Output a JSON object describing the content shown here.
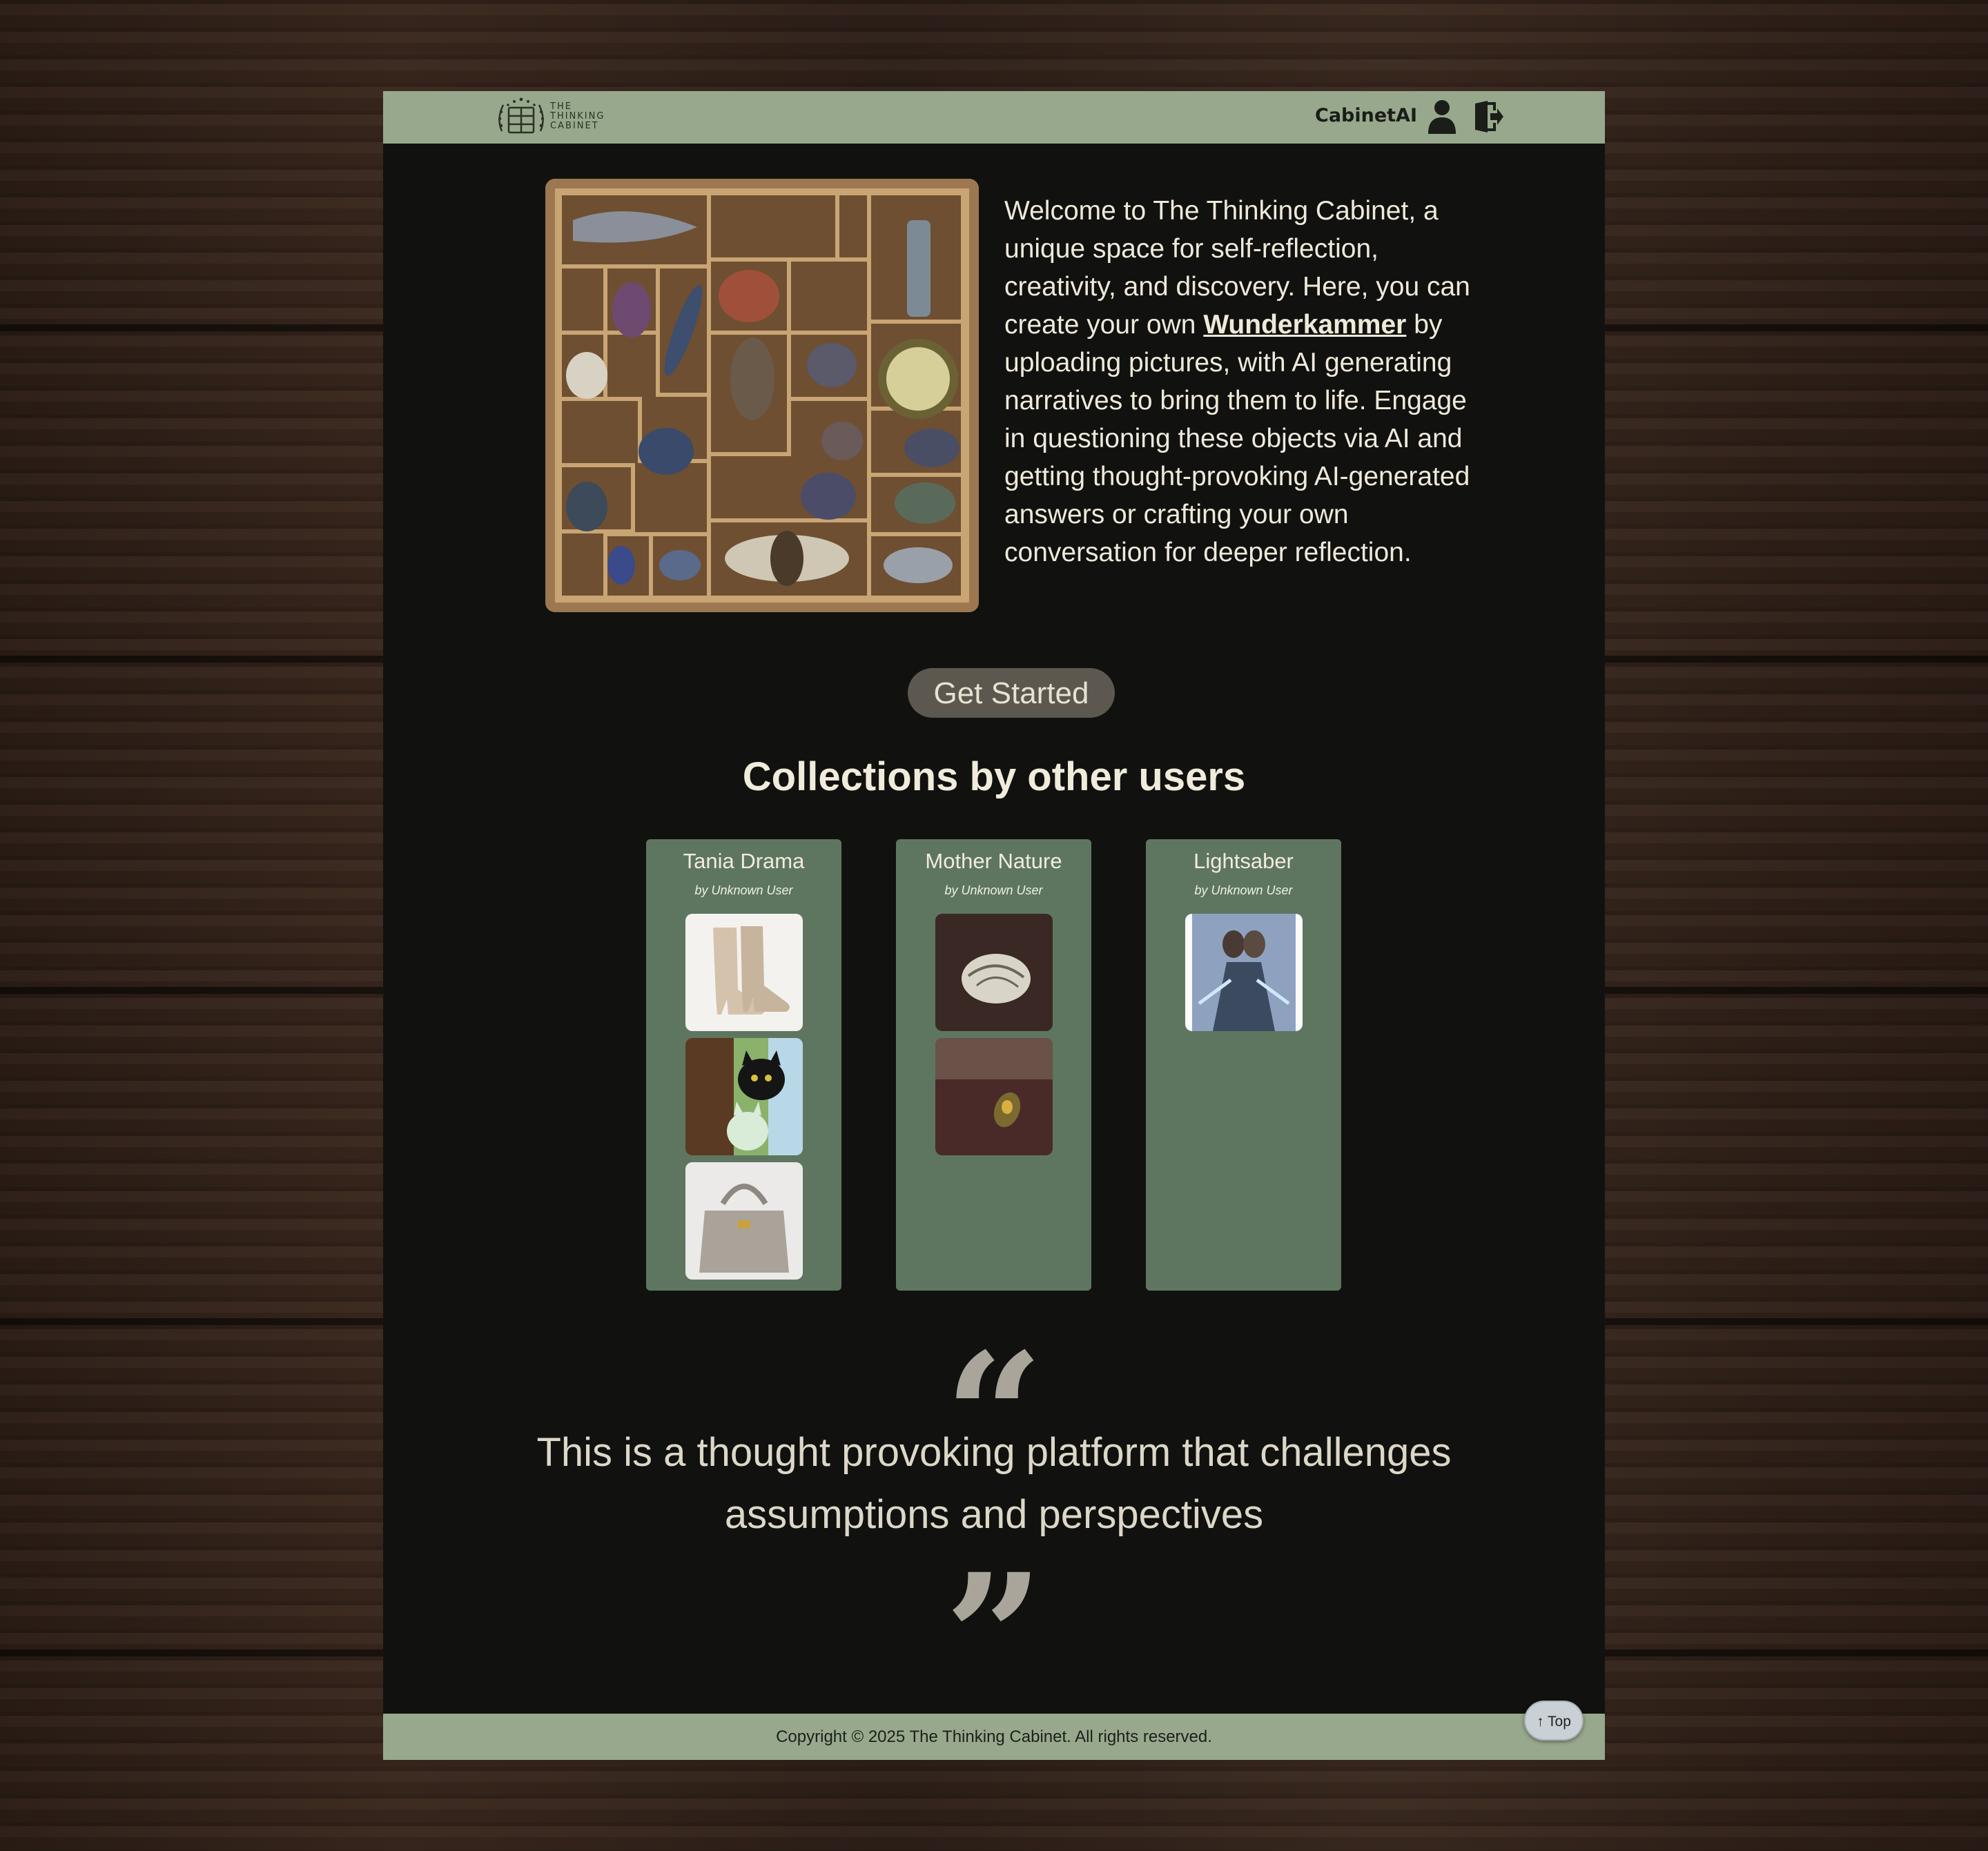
{
  "header": {
    "logo_lines": [
      "THE",
      "THINKING",
      "CABINET"
    ],
    "brand": "CabinetAI",
    "icons": [
      "user-icon",
      "logout-icon"
    ]
  },
  "hero": {
    "image_name": "curiosity-cabinet-painting",
    "text_before": "Welcome to The Thinking Cabinet, a unique space for self-reflection, creativity, and discovery. Here, you can create your own ",
    "link_text": "Wunderkammer",
    "text_after": " by uploading pictures, with AI generating narratives to bring them to life. Engage in questioning these objects via AI and getting thought-provoking AI-generated answers or crafting your own conversation for deeper reflection."
  },
  "cta": {
    "label": "Get Started"
  },
  "collections": {
    "title": "Collections by other users",
    "cards": [
      {
        "title": "Tania Drama",
        "by": "by Unknown User",
        "thumbs": [
          "beige-ankle-boots",
          "black-cat-and-plush-toy",
          "grey-handbag"
        ]
      },
      {
        "title": "Mother Nature",
        "by": "by Unknown User",
        "thumbs": [
          "seashell",
          "amber-stone"
        ]
      },
      {
        "title": "Lightsaber",
        "by": "by Unknown User",
        "thumbs": [
          "lightsaber-duo-poster"
        ]
      }
    ]
  },
  "quote": {
    "open_mark": "“",
    "text": "This is a thought provoking platform that challenges assumptions and perspectives",
    "close_mark": "”"
  },
  "footer": {
    "copyright": "Copyright © 2025 The Thinking Cabinet. All rights reserved.",
    "top_button": "↑ Top"
  },
  "colors": {
    "header_bg": "#98a88c",
    "page_bg": "#11120f",
    "card_bg": "#5e7660",
    "button_bg": "#5c584f"
  }
}
